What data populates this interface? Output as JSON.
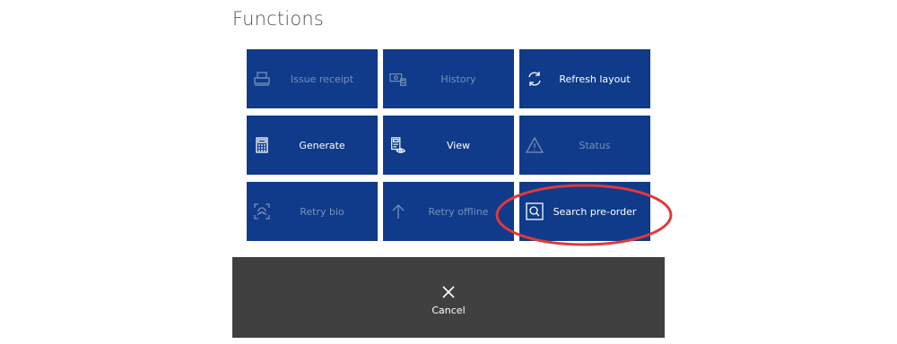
{
  "page": {
    "title": "Functions"
  },
  "tiles": [
    {
      "label": "Issue receipt",
      "icon": "printer-icon",
      "enabled": false
    },
    {
      "label": "History",
      "icon": "cash-history-icon",
      "enabled": false
    },
    {
      "label": "Refresh layout",
      "icon": "refresh-icon",
      "enabled": true
    },
    {
      "label": "Generate",
      "icon": "calculator-icon",
      "enabled": true
    },
    {
      "label": "View",
      "icon": "view-document-icon",
      "enabled": true
    },
    {
      "label": "Status",
      "icon": "warning-icon",
      "enabled": false
    },
    {
      "label": "Retry bio",
      "icon": "fingerprint-scan-icon",
      "enabled": false
    },
    {
      "label": "Retry offline",
      "icon": "arrow-up-icon",
      "enabled": false
    },
    {
      "label": "Search pre-order",
      "icon": "search-box-icon",
      "enabled": true
    }
  ],
  "cancel": {
    "label": "Cancel",
    "icon": "close-icon"
  },
  "colors": {
    "tile_bg": "#0f3b8a",
    "tile_text": "#ffffff",
    "tile_text_disabled": "#7a8fb8",
    "cancel_bg": "#404040",
    "highlight": "#e0393a"
  }
}
